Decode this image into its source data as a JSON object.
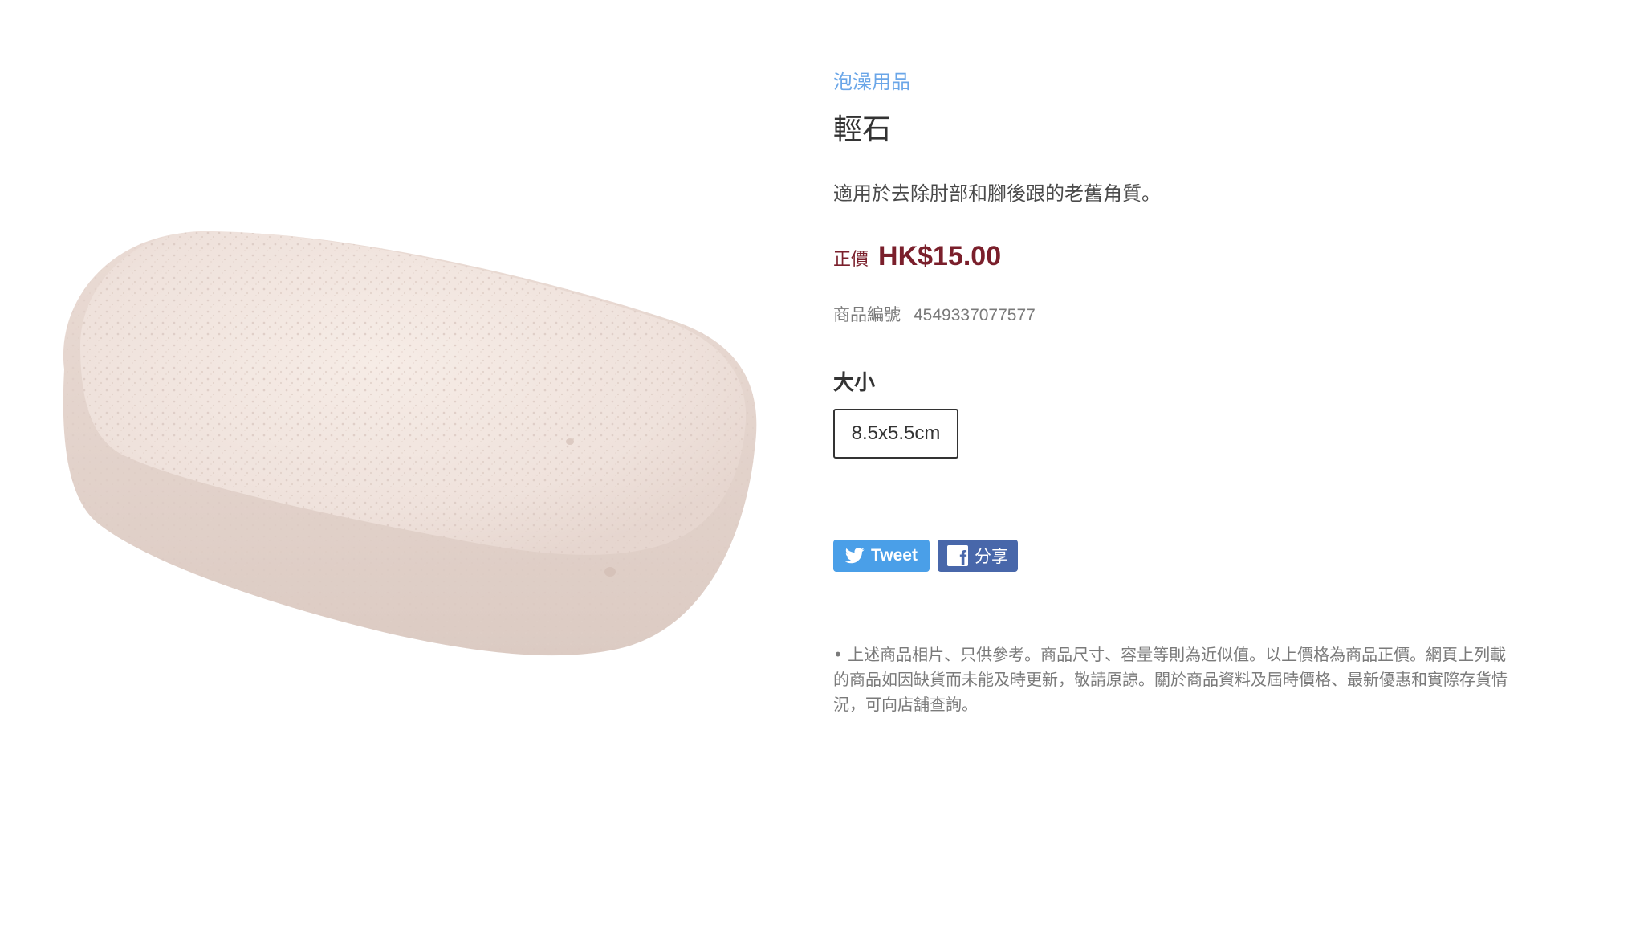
{
  "product": {
    "category": "泡澡用品",
    "title": "輕石",
    "description": "適用於去除肘部和腳後跟的老舊角質。",
    "price_label": "正價",
    "price": "HK$15.00",
    "sku_label": "商品編號",
    "sku": "4549337077577",
    "size_label": "大小",
    "size_option": "8.5x5.5cm"
  },
  "share": {
    "tweet_label": "Tweet",
    "facebook_label": "分享",
    "tweet_color": "#4a9fe8",
    "facebook_color": "#4867aa"
  },
  "disclaimer": "• 上述商品相片、只供參考。商品尺寸、容量等則為近似值。以上價格為商品正價。網頁上列載的商品如因缺貨而未能及時更新，敬請原諒。關於商品資料及屆時價格、最新優惠和實際存貨情況，可向店舖查詢。",
  "colors": {
    "category": "#6aa6e8",
    "price": "#7a1f2b"
  }
}
